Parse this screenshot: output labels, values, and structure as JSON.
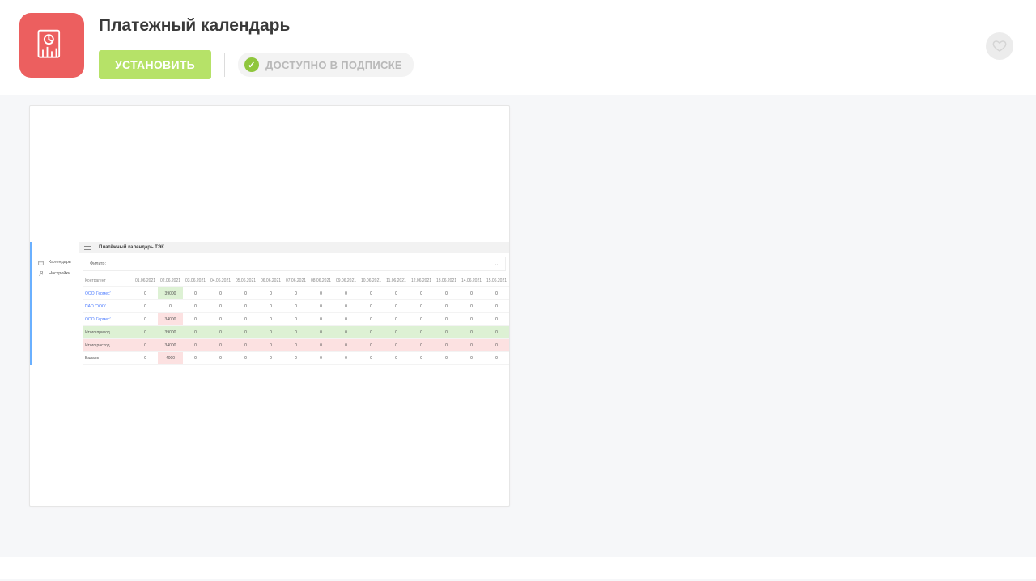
{
  "header": {
    "title": "Платежный календарь",
    "install_label": "УСТАНОВИТЬ",
    "available_label": "ДОСТУПНО В ПОДПИСКЕ"
  },
  "mock": {
    "sidebar": {
      "items": [
        {
          "label": "Календарь"
        },
        {
          "label": "Настройки"
        }
      ]
    },
    "title": "Платёжный календарь ТЭК",
    "filter_label": "Фильтр:",
    "table": {
      "first_header": "Контрагент",
      "date_headers": [
        "01.06.2021",
        "02.06.2021",
        "03.06.2021",
        "04.06.2021",
        "05.06.2021",
        "06.06.2021",
        "07.06.2021",
        "08.06.2021",
        "09.06.2021",
        "10.06.2021",
        "11.06.2021",
        "12.06.2021",
        "13.06.2021",
        "14.06.2021",
        "15.06.2021"
      ],
      "rows": [
        {
          "label": "ООО 'Гермес'",
          "link": true,
          "kind": "income",
          "cells": [
            "0",
            "39000",
            "0",
            "0",
            "0",
            "0",
            "0",
            "0",
            "0",
            "0",
            "0",
            "0",
            "0",
            "0",
            "0"
          ]
        },
        {
          "label": "ПАО 'ООО'",
          "link": true,
          "kind": "plain",
          "cells": [
            "0",
            "0",
            "0",
            "0",
            "0",
            "0",
            "0",
            "0",
            "0",
            "0",
            "0",
            "0",
            "0",
            "0",
            "0"
          ]
        },
        {
          "label": "ООО 'Гермес'",
          "link": true,
          "kind": "expense",
          "cells": [
            "0",
            "34000",
            "0",
            "0",
            "0",
            "0",
            "0",
            "0",
            "0",
            "0",
            "0",
            "0",
            "0",
            "0",
            "0"
          ]
        },
        {
          "label": "Итого приход",
          "link": false,
          "kind": "income_row",
          "cells": [
            "0",
            "39000",
            "0",
            "0",
            "0",
            "0",
            "0",
            "0",
            "0",
            "0",
            "0",
            "0",
            "0",
            "0",
            "0"
          ]
        },
        {
          "label": "Итого расход",
          "link": false,
          "kind": "expense_row",
          "cells": [
            "0",
            "34000",
            "0",
            "0",
            "0",
            "0",
            "0",
            "0",
            "0",
            "0",
            "0",
            "0",
            "0",
            "0",
            "0"
          ]
        },
        {
          "label": "Баланс",
          "link": false,
          "kind": "balance",
          "cells": [
            "0",
            "4000",
            "0",
            "0",
            "0",
            "0",
            "0",
            "0",
            "0",
            "0",
            "0",
            "0",
            "0",
            "0",
            "0"
          ]
        }
      ]
    }
  }
}
